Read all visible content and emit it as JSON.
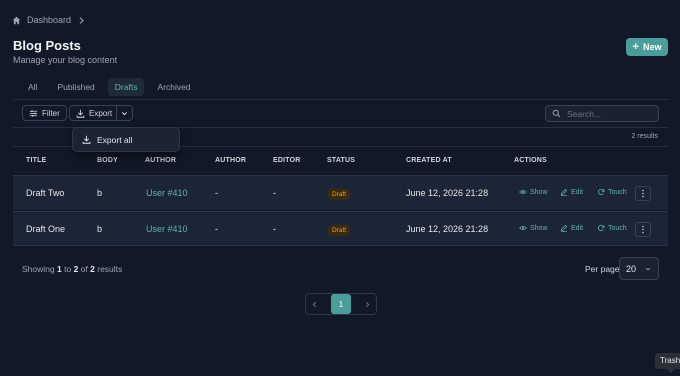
{
  "breadcrumb": {
    "home_icon": "home-icon",
    "label": "Dashboard",
    "separator_icon": "chevron-right-icon"
  },
  "header": {
    "title": "Blog Posts",
    "subtitle": "Manage your blog content",
    "new_button": {
      "icon": "plus-icon",
      "label": "New"
    }
  },
  "tabs": [
    {
      "label": "All",
      "active": false
    },
    {
      "label": "Published",
      "active": false
    },
    {
      "label": "Drafts",
      "active": true
    },
    {
      "label": "Archived",
      "active": false
    }
  ],
  "toolbar": {
    "filter_label": "Filter",
    "export_label": "Export",
    "search_placeholder": "Search...",
    "dropdown_item": "Export all",
    "results_count": "2 results"
  },
  "table": {
    "columns": [
      "TITLE",
      "BODY",
      "AUTHOR",
      "AUTHOR",
      "EDITOR",
      "STATUS",
      "CREATED AT",
      "ACTIONS"
    ],
    "rows": [
      {
        "title": "Draft Two",
        "body": "b",
        "author": "User #410",
        "author2": "-",
        "editor": "-",
        "status": "Draft",
        "created_at": "June 12, 2026 21:28"
      },
      {
        "title": "Draft One",
        "body": "b",
        "author": "User #410",
        "author2": "-",
        "editor": "-",
        "status": "Draft",
        "created_at": "June 12, 2026 21:28"
      }
    ],
    "actions": {
      "show": "Show",
      "edit": "Edit",
      "touch": "Touch"
    }
  },
  "pagination": {
    "showing_prefix": "Showing",
    "from": "1",
    "to_word": "to",
    "to": "2",
    "of_word": "of",
    "total": "2",
    "results_word": "results",
    "per_page_label": "Per page",
    "per_page_value": "20",
    "current_page": "1"
  },
  "tooltip": "Trash",
  "colors": {
    "background": "#111827",
    "accent": "#4a9d9a",
    "link": "#5eb3ae",
    "draft_badge": "#f59e0b"
  }
}
